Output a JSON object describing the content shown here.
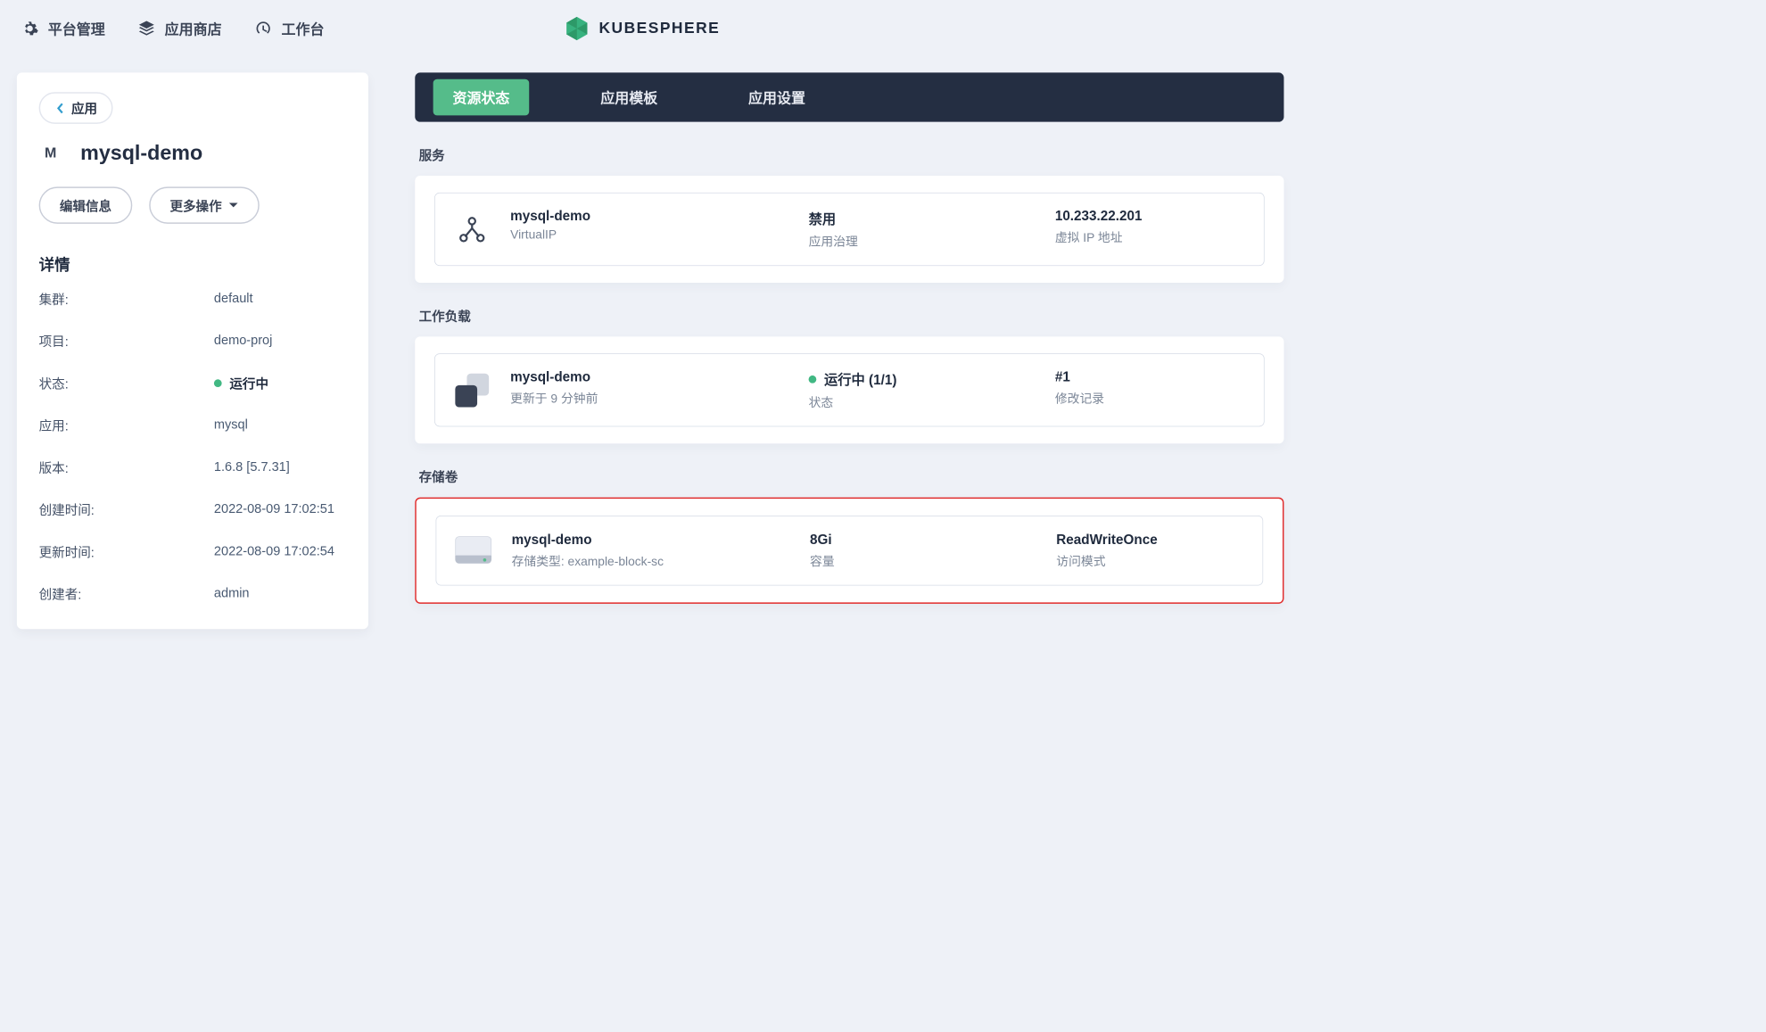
{
  "topnav": {
    "platform": "平台管理",
    "appstore": "应用商店",
    "workbench": "工作台",
    "brand": "KUBESPHERE"
  },
  "sidebar": {
    "back_label": "应用",
    "badge": "M",
    "title": "mysql-demo",
    "edit_btn": "编辑信息",
    "more_btn": "更多操作",
    "section": "详情",
    "rows": {
      "cluster_label": "集群:",
      "cluster_value": "default",
      "project_label": "项目:",
      "project_value": "demo-proj",
      "status_label": "状态:",
      "status_value": "运行中",
      "app_label": "应用:",
      "app_value": "mysql",
      "version_label": "版本:",
      "version_value": "1.6.8 [5.7.31]",
      "created_label": "创建时间:",
      "created_value": "2022-08-09 17:02:51",
      "updated_label": "更新时间:",
      "updated_value": "2022-08-09 17:02:54",
      "author_label": "创建者:",
      "author_value": "admin"
    }
  },
  "tabs": {
    "status": "资源状态",
    "template": "应用模板",
    "settings": "应用设置"
  },
  "services": {
    "heading": "服务",
    "item": {
      "name": "mysql-demo",
      "type": "VirtualIP",
      "govern_status": "禁用",
      "govern_label": "应用治理",
      "vip": "10.233.22.201",
      "vip_label": "虚拟 IP 地址"
    }
  },
  "workloads": {
    "heading": "工作负载",
    "item": {
      "name": "mysql-demo",
      "updated": "更新于 9 分钟前",
      "status": "运行中 (1/1)",
      "status_label": "状态",
      "rev": "#1",
      "rev_label": "修改记录"
    }
  },
  "volumes": {
    "heading": "存储卷",
    "item": {
      "name": "mysql-demo",
      "sc": "存储类型: example-block-sc",
      "capacity": "8Gi",
      "capacity_label": "容量",
      "mode": "ReadWriteOnce",
      "mode_label": "访问模式"
    }
  }
}
